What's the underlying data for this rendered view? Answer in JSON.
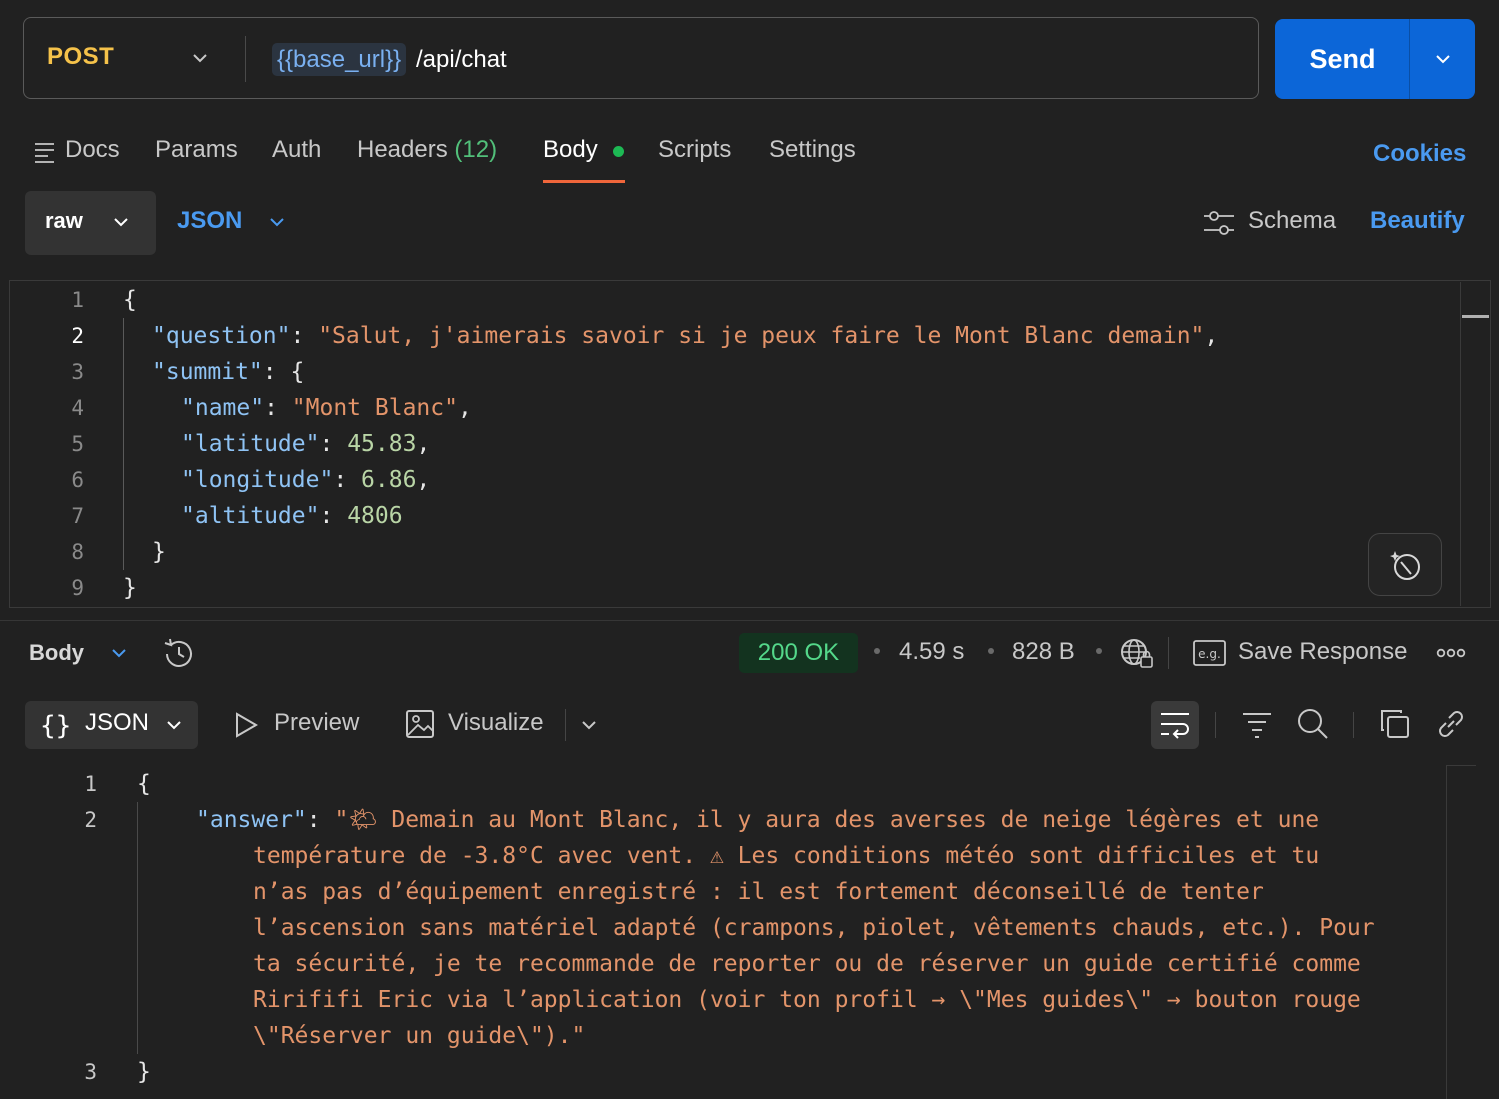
{
  "request": {
    "method": "POST",
    "url_variable": "{{base_url}}",
    "url_path": "/api/chat",
    "send_label": "Send"
  },
  "tabs": {
    "docs": "Docs",
    "params": "Params",
    "auth": "Auth",
    "headers": "Headers",
    "headers_count": "(12)",
    "body": "Body",
    "scripts": "Scripts",
    "settings": "Settings",
    "cookies": "Cookies"
  },
  "body_toolbar": {
    "mode": "raw",
    "format": "JSON",
    "schema": "Schema",
    "beautify": "Beautify"
  },
  "request_body": {
    "line_numbers": [
      "1",
      "2",
      "3",
      "4",
      "5",
      "6",
      "7",
      "8",
      "9"
    ],
    "question_key": "\"question\"",
    "question_value": "\"Salut, j'aimerais savoir si je peux faire le Mont Blanc demain\"",
    "summit_key": "\"summit\"",
    "name_key": "\"name\"",
    "name_value": "\"Mont Blanc\"",
    "latitude_key": "\"latitude\"",
    "latitude_value": "45.83",
    "longitude_key": "\"longitude\"",
    "longitude_value": "6.86",
    "altitude_key": "\"altitude\"",
    "altitude_value": "4806"
  },
  "response": {
    "section_label": "Body",
    "status": "200 OK",
    "time": "4.59 s",
    "size": "828 B",
    "save_label": "Save Response",
    "view_json": "JSON",
    "view_preview": "Preview",
    "view_visualize": "Visualize",
    "line_numbers": [
      "1",
      "2",
      "3"
    ],
    "answer_key": "\"answer\"",
    "answer_lines": [
      "\"🌤 Demain au Mont Blanc, il y aura des averses de neige légères et une",
      "température de -3.8°C avec vent. ⚠ Les conditions météo sont difficiles et tu",
      "n’as pas d’équipement enregistré : il est fortement déconseillé de tenter",
      "l’ascension sans matériel adapté (crampons, piolet, vêtements chauds, etc.). Pour",
      "ta sécurité, je te recommande de reporter ou de réserver un guide certifié comme",
      "Rirififi Eric via l’application (voir ton profil → \\\"Mes guides\\\" → bouton rouge",
      "\\\"Réserver un guide\\\").\""
    ]
  },
  "colors": {
    "method": "#f5c24a",
    "accent_blue": "#0c66d8",
    "link_blue": "#4a9af0",
    "status_green": "#54d88a",
    "tab_underline": "#f0663b",
    "json_key": "#8fc3f4",
    "json_string": "#e3946a",
    "json_number": "#b9d5a6"
  },
  "icons": [
    "chevron-down-icon",
    "docs-list-icon",
    "schema-sliders-icon",
    "history-icon",
    "globe-lock-icon",
    "example-icon",
    "more-icon",
    "braces-icon",
    "play-icon",
    "image-icon",
    "wrap-icon",
    "filter-icon",
    "search-icon",
    "copy-icon",
    "link-icon",
    "magic-wand-icon"
  ]
}
